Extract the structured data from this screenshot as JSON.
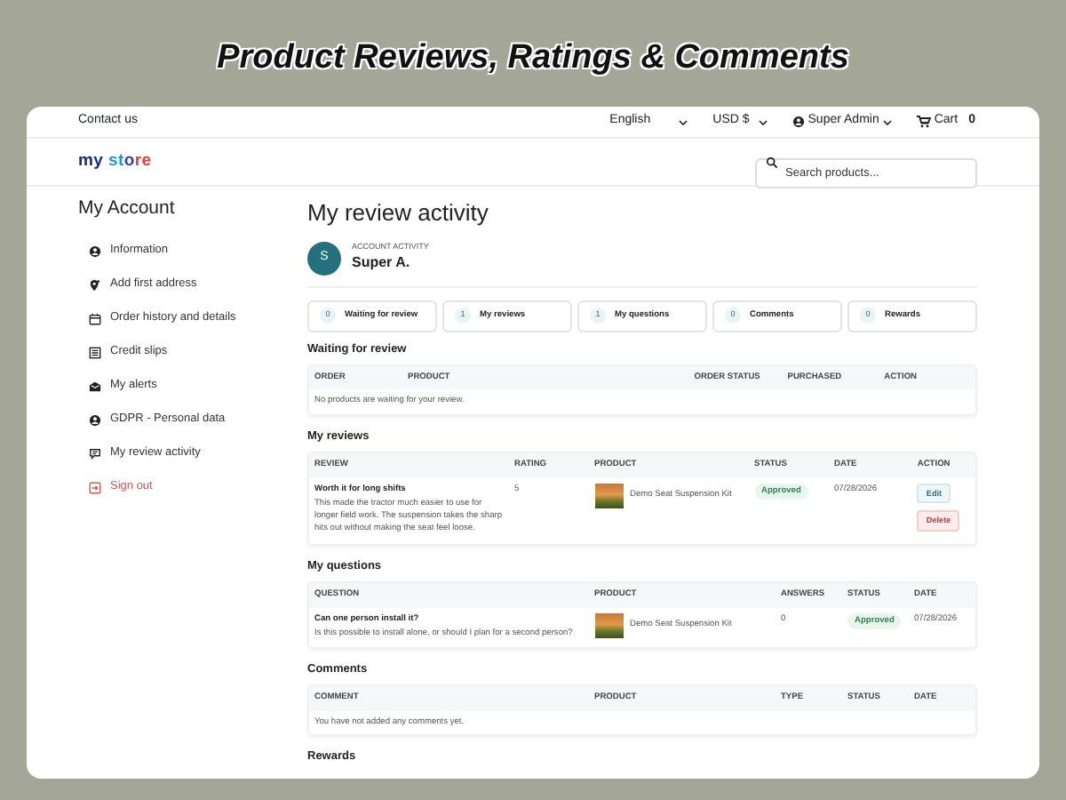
{
  "banner": {
    "title": "Product Reviews, Ratings & Comments"
  },
  "topbar": {
    "contact": "Contact us",
    "language": "English",
    "currency": "USD $",
    "user": "Super Admin",
    "cart_label": "Cart",
    "cart_count": "0"
  },
  "header": {
    "logo": "my store",
    "search": {
      "placeholder": "Search products..."
    }
  },
  "sidebar": {
    "title": "My Account",
    "items": [
      {
        "label": "Information",
        "kind": "person"
      },
      {
        "label": "Add first address",
        "kind": "pin"
      },
      {
        "label": "Order history and details",
        "kind": "calendar"
      },
      {
        "label": "Credit slips",
        "kind": "slip"
      },
      {
        "label": "My alerts",
        "kind": "mail"
      },
      {
        "label": "GDPR - Personal data",
        "kind": "person"
      },
      {
        "label": "My review activity",
        "kind": "chat"
      },
      {
        "label": "Sign out",
        "kind": "signout"
      }
    ]
  },
  "page_title": "My review activity",
  "account": {
    "initial": "S",
    "caption": "ACCOUNT ACTIVITY",
    "name": "Super A."
  },
  "tabs": [
    {
      "count": "0",
      "label": "Waiting for review"
    },
    {
      "count": "1",
      "label": "My reviews"
    },
    {
      "count": "1",
      "label": "My questions"
    },
    {
      "count": "0",
      "label": "Comments"
    },
    {
      "count": "0",
      "label": "Rewards"
    }
  ],
  "sections": [
    {
      "kind": "waiting",
      "title": "Waiting for review",
      "columns": [
        "ORDER",
        "PRODUCT",
        "ORDER STATUS",
        "PURCHASED",
        "ACTION"
      ],
      "empty": "No products are waiting for your review."
    },
    {
      "kind": "reviews",
      "title": "My reviews",
      "columns": [
        "REVIEW",
        "RATING",
        "PRODUCT",
        "STATUS",
        "DATE",
        "ACTION"
      ],
      "rows": [
        {
          "title": "Worth it for long shifts",
          "body": "This made the tractor much easier to use for longer field work. The suspension takes the sharp hits out without making the seat feel loose.",
          "rating": "5",
          "product": "Demo Seat Suspension Kit",
          "status": "Approved",
          "date": "07/28/2026",
          "actions": [
            "Edit",
            "Delete"
          ]
        }
      ]
    },
    {
      "kind": "questions",
      "title": "My questions",
      "columns": [
        "QUESTION",
        "PRODUCT",
        "ANSWERS",
        "STATUS",
        "DATE"
      ],
      "rows": [
        {
          "title": "Can one person install it?",
          "body": "Is this possible to install alone, or should I plan for a second person?",
          "product": "Demo Seat Suspension Kit",
          "answers": "0",
          "status": "Approved",
          "date": "07/28/2026"
        }
      ]
    },
    {
      "kind": "comments",
      "title": "Comments",
      "columns": [
        "COMMENT",
        "PRODUCT",
        "TYPE",
        "STATUS",
        "DATE"
      ],
      "empty": "You have not added any comments yet."
    },
    {
      "kind": "rewards",
      "title": "Rewards"
    }
  ]
}
